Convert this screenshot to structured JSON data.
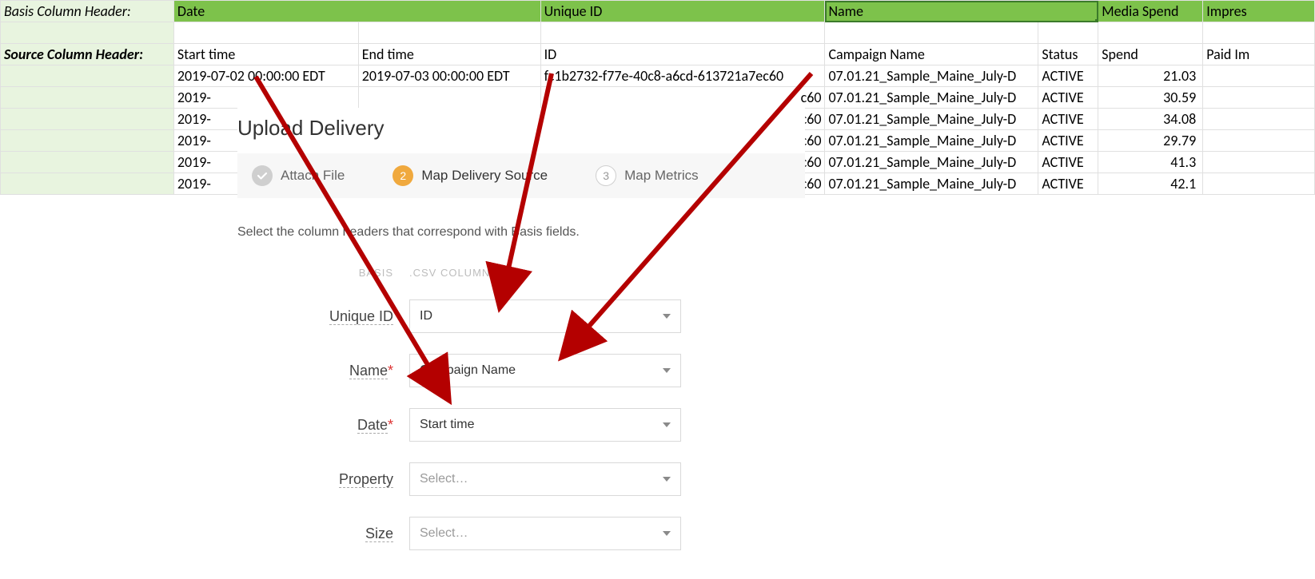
{
  "basis_row": {
    "label": "Basis Column Header:",
    "date": "Date",
    "unique_id": "Unique ID",
    "name": "Name",
    "media_spend": "Media Spend",
    "impress": "Impres"
  },
  "source_row": {
    "label": "Source Column Header:",
    "start": "Start time",
    "end": "End time",
    "id": "ID",
    "cn": "Campaign Name",
    "status": "Status",
    "spend": "Spend",
    "paid": "Paid Im"
  },
  "rows": [
    {
      "start": "2019-07-02 00:00:00 EDT",
      "end": "2019-07-03 00:00:00 EDT",
      "id": "fc1b2732-f77e-40c8-a6cd-613721a7ec60",
      "cn": "07.01.21_Sample_Maine_July-D",
      "status": "ACTIVE",
      "spend": "21.03"
    },
    {
      "start": "2019-",
      "end": "",
      "id": "c60",
      "cn": "07.01.21_Sample_Maine_July-D",
      "status": "ACTIVE",
      "spend": "30.59"
    },
    {
      "start": "2019-",
      "end": "",
      "id": "c60",
      "cn": "07.01.21_Sample_Maine_July-D",
      "status": "ACTIVE",
      "spend": "34.08"
    },
    {
      "start": "2019-",
      "end": "",
      "id": "c60",
      "cn": "07.01.21_Sample_Maine_July-D",
      "status": "ACTIVE",
      "spend": "29.79"
    },
    {
      "start": "2019-",
      "end": "",
      "id": "c60",
      "cn": "07.01.21_Sample_Maine_July-D",
      "status": "ACTIVE",
      "spend": "41.3"
    },
    {
      "start": "2019-",
      "end": "",
      "id": "c60",
      "cn": "07.01.21_Sample_Maine_July-D",
      "status": "ACTIVE",
      "spend": "42.1"
    }
  ],
  "dialog": {
    "title": "Upload Delivery",
    "step1": "Attach File",
    "step2": "Map Delivery Source",
    "step2_num": "2",
    "step3": "Map Metrics",
    "step3_num": "3",
    "instruct": "Select the column headers that correspond with Basis fields.",
    "head_left": "BASIS",
    "head_right": ".CSV COLUMNS",
    "f1_label": "Unique ID",
    "f1_val": "ID",
    "f2_label": "Name",
    "f2_val": "Campaign Name",
    "f3_label": "Date",
    "f3_val": "Start time",
    "f4_label": "Property",
    "f4_val": "Select…",
    "f5_label": "Size",
    "f5_val": "Select…"
  }
}
